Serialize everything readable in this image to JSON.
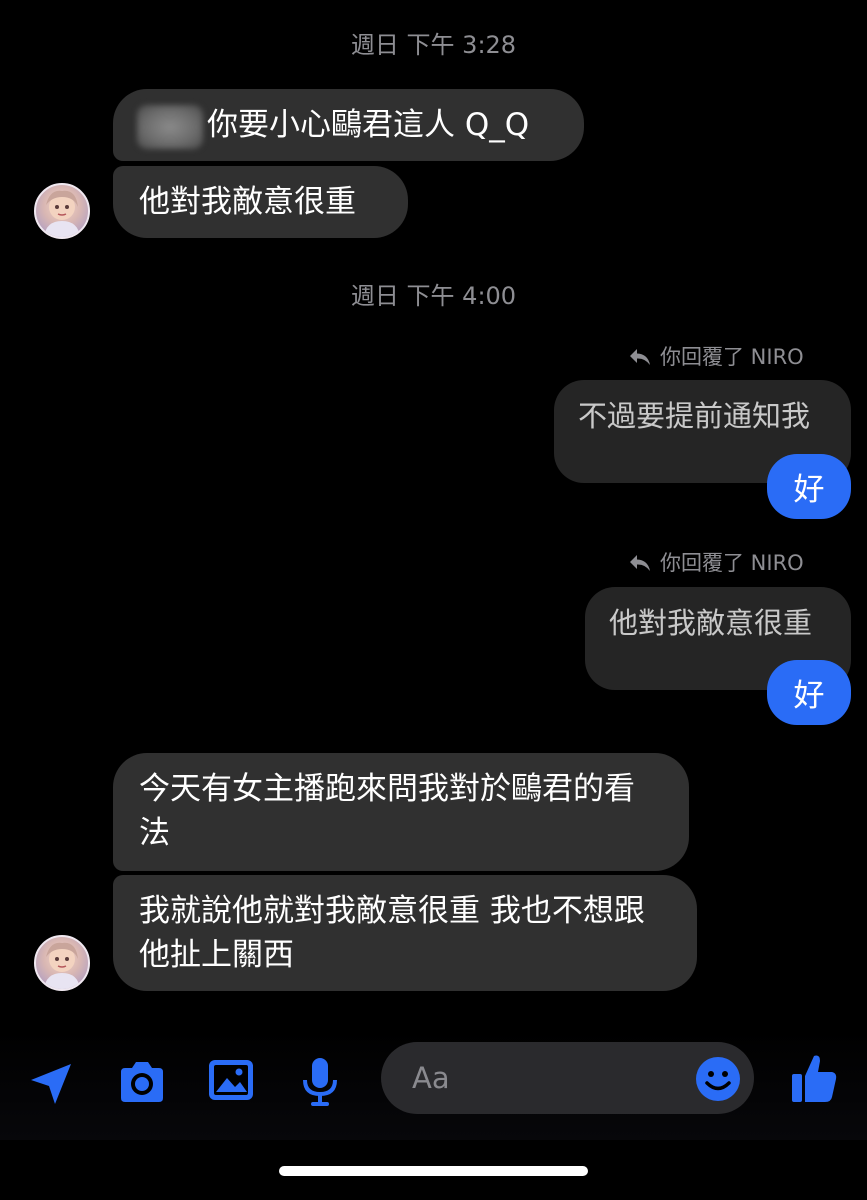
{
  "timestamps": [
    "週日 下午 3:28",
    "週日 下午 4:00"
  ],
  "messages": {
    "in1": "你要小心鷗君這人 Q_Q",
    "in2": "他對我敵意很重",
    "reply1_label": "你回覆了 NIRO",
    "reply1_quote": "不過要提前通知我",
    "reply1_text": "好",
    "reply2_label": "你回覆了 NIRO",
    "reply2_quote": "他對我敵意很重",
    "reply2_text": "好",
    "in3": "今天有女主播跑來問我對於鷗君的看法",
    "in4": "我就說他就對我敵意很重 我也不想跟他扯上關西"
  },
  "composer": {
    "placeholder": "Aa",
    "icons": [
      "location-arrow-icon",
      "camera-icon",
      "image-icon",
      "microphone-icon",
      "emoji-icon",
      "thumbs-up-icon"
    ]
  },
  "colors": {
    "accent": "#2a6cf6",
    "incoming_bubble": "#303030",
    "outgoing_quote_bubble": "#252525"
  }
}
